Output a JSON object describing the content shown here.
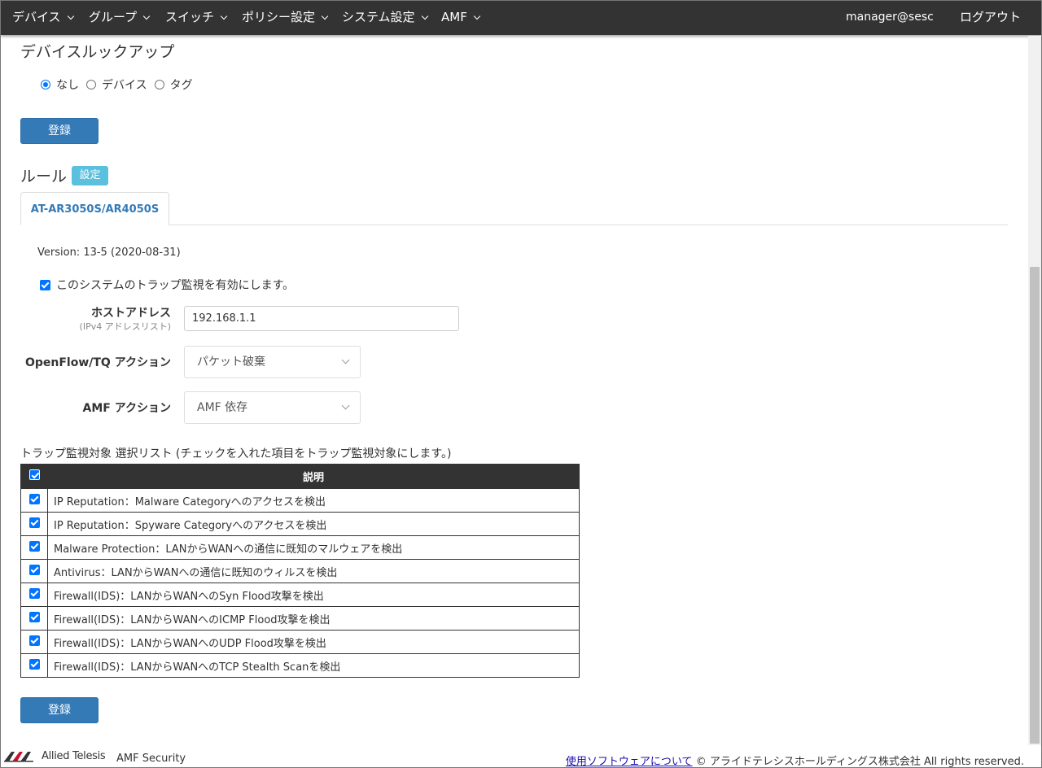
{
  "nav": {
    "items": [
      {
        "label": "デバイス"
      },
      {
        "label": "グループ"
      },
      {
        "label": "スイッチ"
      },
      {
        "label": "ポリシー設定"
      },
      {
        "label": "システム設定"
      },
      {
        "label": "AMF"
      }
    ],
    "user": "manager@sesc",
    "logout": "ログアウト"
  },
  "lookup": {
    "title": "デバイスルックアップ",
    "options": [
      {
        "label": "なし",
        "selected": true
      },
      {
        "label": "デバイス",
        "selected": false
      },
      {
        "label": "タグ",
        "selected": false
      }
    ],
    "register": "登録"
  },
  "rules": {
    "title": "ルール",
    "settings_badge": "設定",
    "tab": "AT-AR3050S/AR4050S",
    "version": "Version: 13-5 (2020-08-31)",
    "enable_label": "このシステムのトラップ監視を有効にします。",
    "host_label": "ホストアドレス",
    "host_sub": "(IPv4 アドレスリスト)",
    "host_value": "192.168.1.1",
    "openflow_label": "OpenFlow/TQ アクション",
    "openflow_value": "パケット破棄",
    "amf_label": "AMF アクション",
    "amf_value": "AMF 依存",
    "list_caption": "トラップ監視対象 選択リスト (チェックを入れた項目をトラップ監視対象にします。)",
    "table_header": "説明",
    "rows": [
      "IP Reputation：Malware Categoryへのアクセスを検出",
      "IP Reputation：Spyware Categoryへのアクセスを検出",
      "Malware Protection：LANからWANへの通信に既知のマルウェアを検出",
      "Antivirus：LANからWANへの通信に既知のウィルスを検出",
      "Firewall(IDS)：LANからWANへのSyn Flood攻撃を検出",
      "Firewall(IDS)：LANからWANへのICMP Flood攻撃を検出",
      "Firewall(IDS)：LANからWANへのUDP Flood攻撃を検出",
      "Firewall(IDS)：LANからWANへのTCP Stealth Scanを検出"
    ],
    "register": "登録"
  },
  "footer": {
    "brand": "Allied Telesis",
    "product": "AMF Security",
    "link": "使用ソフトウェアについて",
    "copyright": "© アライドテレシスホールディングス株式会社 All rights reserved."
  },
  "colors": {
    "nav_bg": "#333333",
    "primary": "#337ab7",
    "badge": "#5bc0de",
    "checkbox": "#0075ff"
  }
}
